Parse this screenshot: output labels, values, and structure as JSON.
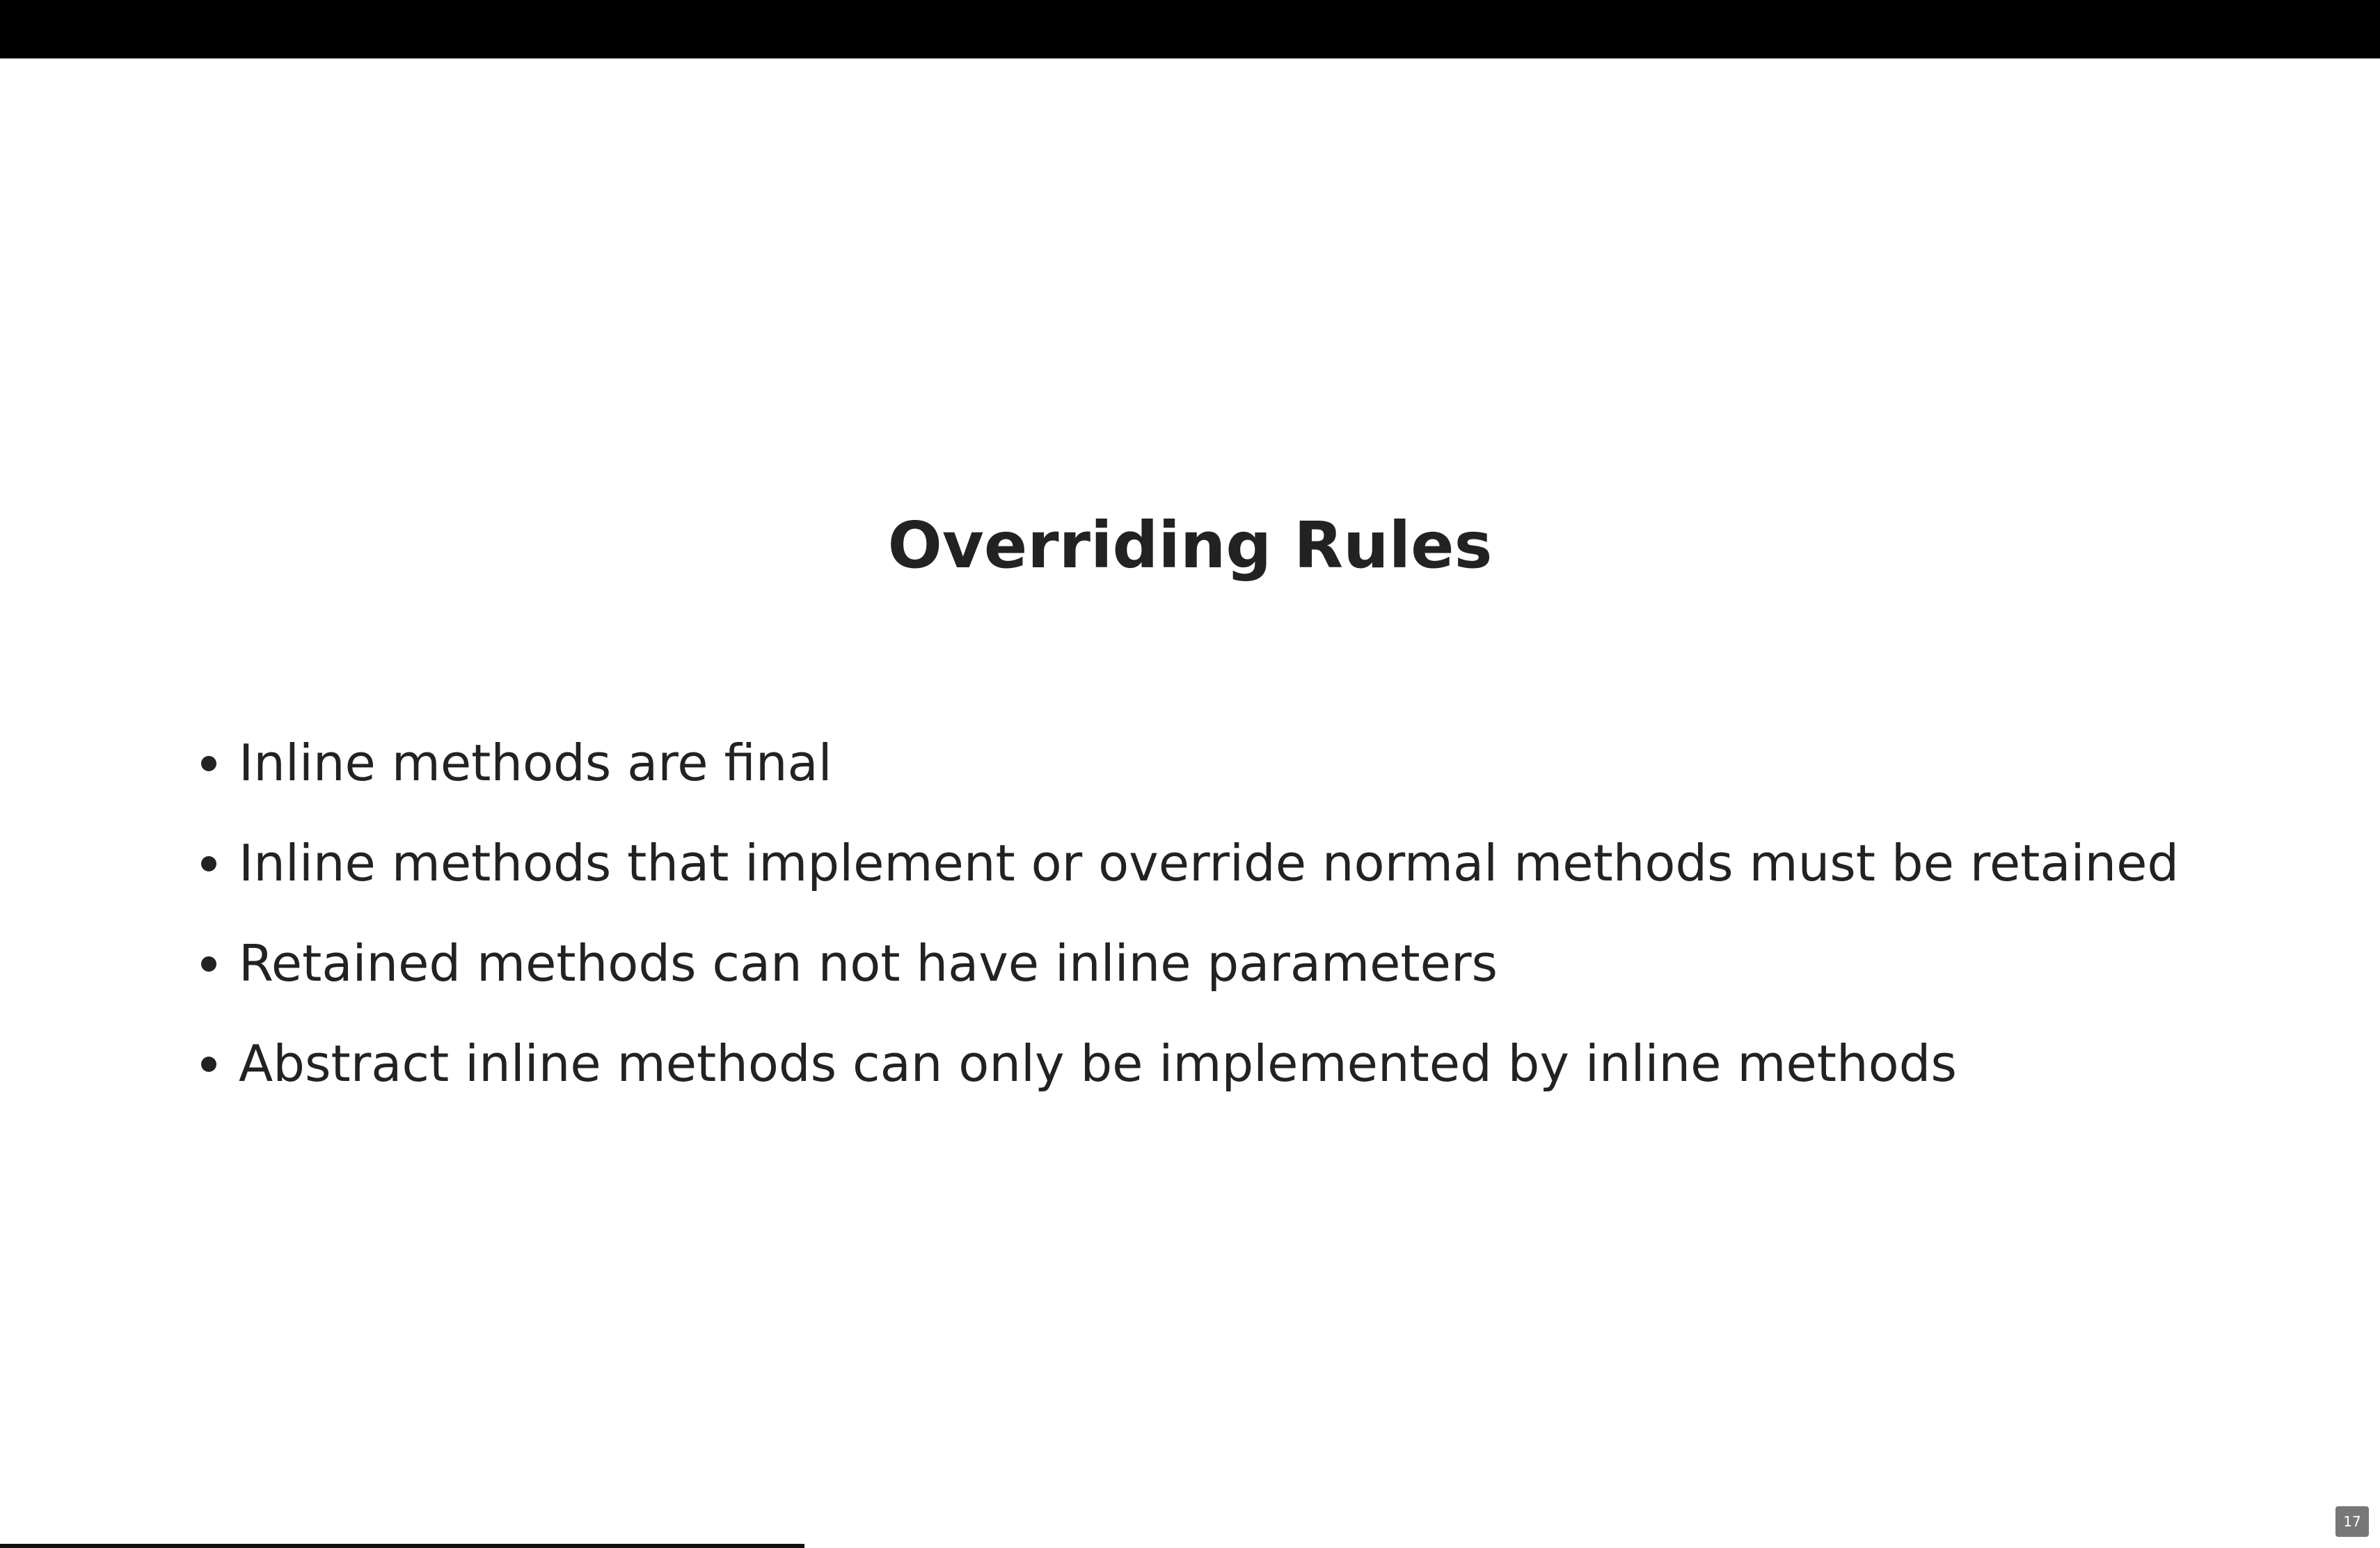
{
  "slide": {
    "title": "Overriding Rules",
    "bullets": [
      "Inline methods are final",
      "Inline methods that implement or override normal methods must be retained",
      "Retained methods can not have inline parameters",
      "Abstract inline methods can only be implemented by inline methods"
    ],
    "page_number": "17"
  },
  "progress": {
    "fraction": 0.338
  },
  "colors": {
    "text": "#222222",
    "top_bar": "#000000",
    "background": "#ffffff",
    "page_badge": "#777777"
  }
}
